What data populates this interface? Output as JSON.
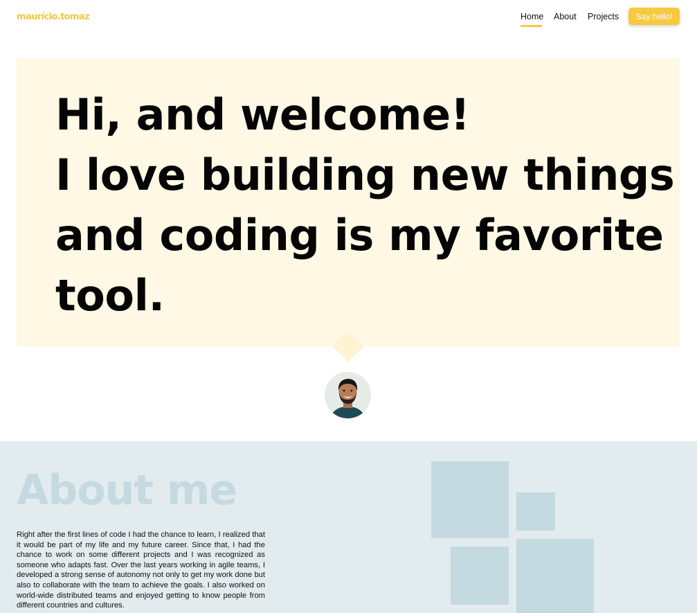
{
  "header": {
    "logo": "maurício.tomaz",
    "nav": {
      "home": "Home",
      "about": "About",
      "projects": "Projects"
    },
    "cta": "Say hello!"
  },
  "hero": {
    "line1": "Hi, and welcome!",
    "line2": "I love building new things",
    "line3": "and coding is my favorite",
    "line4": "tool."
  },
  "about": {
    "title": "About me",
    "text": "Right after the first lines of code I had the chance to learn, I realized that it would be part of my life and my future career. Since that, I had the chance to work on some different projects and I was recognized as someone who adapts fast. Over the last years working in agile teams, I developed a strong sense of autonomy not only to get my work done but also to collaborate with the team to achieve the goals. I also worked on world-wide distributed teams and enjoyed getting to know people from different countries and cultures."
  },
  "colors": {
    "accent": "#f5c842",
    "hero_bg": "#fef8e4",
    "about_bg": "#e2ebee",
    "about_shapes": "#c4dae0"
  }
}
